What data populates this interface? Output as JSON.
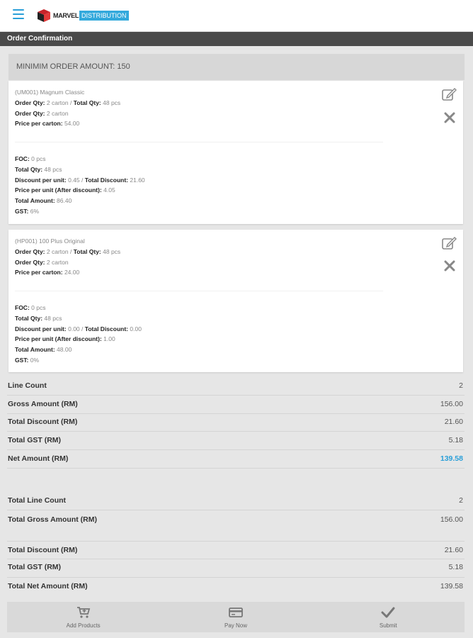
{
  "header": {
    "brand_word1": "MARVEL",
    "brand_word2": "DISTRIBUTION"
  },
  "page_title": "Order Confirmation",
  "minimum_order": "MINIMIM ORDER AMOUNT: 150",
  "items": [
    {
      "title": "(UM001) Magnum Classic",
      "order_qty_label": "Order Qty:",
      "order_qty_value": "2 carton",
      "total_qty_label": "Total Qty:",
      "total_qty_value": "48 pcs",
      "order_qty2_label": "Order Qty:",
      "order_qty2_value": "2 carton",
      "price_carton_label": "Price per carton:",
      "price_carton_value": "54.00",
      "foc_label": "FOC:",
      "foc_value": "0 pcs",
      "tqty_label": "Total Qty:",
      "tqty_value": "48 pcs",
      "disc_unit_label": "Discount per unit:",
      "disc_unit_value": "0.45",
      "total_disc_label": "Total Discount:",
      "total_disc_value": "21.60",
      "price_unit_label": "Price per unit (After discount):",
      "price_unit_value": "4.05",
      "total_amount_label": "Total Amount:",
      "total_amount_value": "86.40",
      "gst_label": "GST:",
      "gst_value": "6%"
    },
    {
      "title": "(HP001) 100 Plus Original",
      "order_qty_label": "Order Qty:",
      "order_qty_value": "2 carton",
      "total_qty_label": "Total Qty:",
      "total_qty_value": "48 pcs",
      "order_qty2_label": "Order Qty:",
      "order_qty2_value": "2 carton",
      "price_carton_label": "Price per carton:",
      "price_carton_value": "24.00",
      "foc_label": "FOC:",
      "foc_value": "0 pcs",
      "tqty_label": "Total Qty:",
      "tqty_value": "48 pcs",
      "disc_unit_label": "Discount per unit:",
      "disc_unit_value": "0.00",
      "total_disc_label": "Total Discount:",
      "total_disc_value": "0.00",
      "price_unit_label": "Price per unit (After discount):",
      "price_unit_value": "1.00",
      "total_amount_label": "Total Amount:",
      "total_amount_value": "48.00",
      "gst_label": "GST:",
      "gst_value": "0%"
    }
  ],
  "summary": {
    "line_count_label": "Line Count",
    "line_count_value": "2",
    "gross_label": "Gross Amount (RM)",
    "gross_value": "156.00",
    "discount_label": "Total Discount (RM)",
    "discount_value": "21.60",
    "gst_label": "Total GST (RM)",
    "gst_value": "5.18",
    "net_label": "Net Amount (RM)",
    "net_value": "139.58"
  },
  "totals": {
    "line_count_label": "Total Line Count",
    "line_count_value": "2",
    "gross_label": "Total Gross Amount (RM)",
    "gross_value": "156.00",
    "discount_label": "Total Discount (RM)",
    "discount_value": "21.60",
    "gst_label": "Total GST (RM)",
    "gst_value": "5.18",
    "net_label": "Total Net Amount (RM)",
    "net_value": "139.58"
  },
  "bottom_nav": {
    "add_products": "Add Products",
    "pay_now": "Pay Now",
    "submit": "Submit"
  },
  "colors": {
    "accent": "#2a9fd8",
    "title_bar": "#4a4a4a",
    "background": "#e6e6e6"
  },
  "icons": [
    "menu-icon",
    "logo-cube-icon",
    "edit-icon",
    "close-icon",
    "cart-icon",
    "card-icon",
    "check-icon"
  ]
}
